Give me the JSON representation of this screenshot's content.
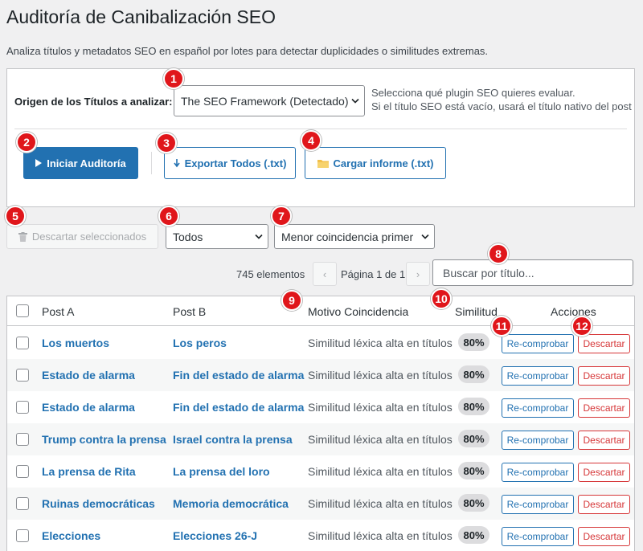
{
  "header": {
    "title": "Auditoría de Canibalización SEO",
    "description": "Analiza títulos y metadatos SEO en español por lotes para detectar duplicidades o similitudes extremas."
  },
  "config": {
    "origin_label": "Origen de los Títulos a analizar:",
    "origin_value": "The SEO Framework (Detectado)",
    "help_line1": "Selecciona qué plugin SEO quieres evaluar.",
    "help_line2": "Si el título SEO está vacío, usará el título nativo del post"
  },
  "buttons": {
    "start": "Iniciar Auditoría",
    "export": "Exportar Todos (.txt)",
    "load": "Cargar informe (.txt)",
    "discard_selected": "Descartar seleccionados"
  },
  "filters": {
    "status_value": "Todos",
    "order_value": "Menor coincidencia primer"
  },
  "pagination": {
    "items": "745 elementos",
    "prev": "‹",
    "next": "›",
    "page_text": "Página 1 de 1"
  },
  "search": {
    "placeholder": "Buscar por título..."
  },
  "table": {
    "columns": {
      "post_a": "Post A",
      "post_b": "Post B",
      "reason": "Motivo Coincidencia",
      "similarity": "Similitud",
      "actions": "Acciones"
    },
    "action_recheck": "Re-comprobar",
    "action_discard": "Descartar",
    "rows": [
      {
        "a": "Los muertos",
        "b": "Los peros",
        "reason": "Similitud léxica alta en títulos",
        "sim": "80%"
      },
      {
        "a": "Estado de alarma",
        "b": "Fin del estado de alarma",
        "reason": "Similitud léxica alta en títulos",
        "sim": "80%"
      },
      {
        "a": "Estado de alarma",
        "b": "Fin del estado de alarma",
        "reason": "Similitud léxica alta en títulos",
        "sim": "80%"
      },
      {
        "a": "Trump contra la prensa",
        "b": "Israel contra la prensa",
        "reason": "Similitud léxica alta en títulos",
        "sim": "80%"
      },
      {
        "a": "La prensa de Rita",
        "b": "La prensa del loro",
        "reason": "Similitud léxica alta en títulos",
        "sim": "80%"
      },
      {
        "a": "Ruinas democráticas",
        "b": "Memoria democrática",
        "reason": "Similitud léxica alta en títulos",
        "sim": "80%"
      },
      {
        "a": "Elecciones",
        "b": "Elecciones 26-J",
        "reason": "Similitud léxica alta en títulos",
        "sim": "80%"
      }
    ]
  },
  "markers": [
    "1",
    "2",
    "3",
    "4",
    "5",
    "6",
    "7",
    "8",
    "9",
    "10",
    "11",
    "12"
  ],
  "colors": {
    "accent": "#2271b1",
    "danger": "#d63638",
    "marker": "#e0161b"
  }
}
